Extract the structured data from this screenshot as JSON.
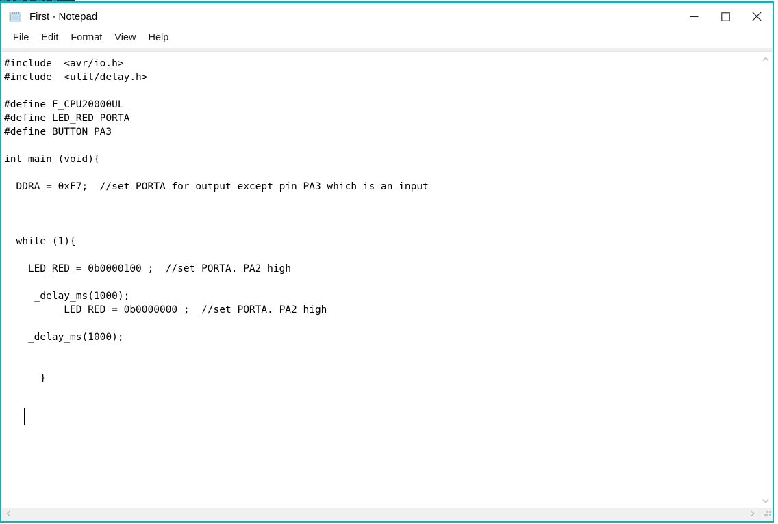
{
  "window": {
    "title": "First - Notepad",
    "app_icon": "notepad-icon",
    "border_color": "#12b0b7",
    "background": "#ffffff"
  },
  "window_controls": [
    {
      "name": "minimize",
      "glyph": "minimize-icon",
      "label": "Minimize"
    },
    {
      "name": "maximize",
      "glyph": "maximize-icon",
      "label": "Maximize"
    },
    {
      "name": "close",
      "glyph": "close-icon",
      "label": "Close"
    }
  ],
  "menu": {
    "items": [
      {
        "label": "File"
      },
      {
        "label": "Edit"
      },
      {
        "label": "Format"
      },
      {
        "label": "View"
      },
      {
        "label": "Help"
      }
    ]
  },
  "editor": {
    "font": "monospace",
    "text_color": "#000000",
    "caret_visible": true,
    "content": "#include  <avr/io.h>\n#include  <util/delay.h>\n\n#define F_CPU20000UL\n#define LED_RED PORTA\n#define BUTTON PA3\n\nint main (void){\n\n  DDRA = 0xF7;  //set PORTA for output except pin PA3 which is an input\n\n\n\n  while (1){\n\n    LED_RED = 0b0000100 ;  //set PORTA. PA2 high\n\n     _delay_ms(1000);\n          LED_RED = 0b0000000 ;  //set PORTA. PA2 high\n\n    _delay_ms(1000);\n\n\n      }",
    "lines": [
      "#include  <avr/io.h>",
      "#include  <util/delay.h>",
      "",
      "#define F_CPU20000UL",
      "#define LED_RED PORTA",
      "#define BUTTON PA3",
      "",
      "int main (void){",
      "",
      "  DDRA = 0xF7;  //set PORTA for output except pin PA3 which is an input",
      "",
      "",
      "",
      "  while (1){",
      "",
      "    LED_RED = 0b0000100 ;  //set PORTA. PA2 high",
      "",
      "     _delay_ms(1000);",
      "          LED_RED = 0b0000000 ;  //set PORTA. PA2 high",
      "",
      "    _delay_ms(1000);",
      "",
      "",
      "      }"
    ]
  },
  "scrollbars": {
    "vertical": {
      "up_arrow": "chevron-up-icon",
      "down_arrow": "chevron-down-icon",
      "thumb_visible": false
    },
    "horizontal": {
      "left_arrow": "chevron-left-icon",
      "right_arrow": "chevron-right-icon",
      "thumb_visible": false
    },
    "resize_grip": "resize-grip-icon"
  }
}
